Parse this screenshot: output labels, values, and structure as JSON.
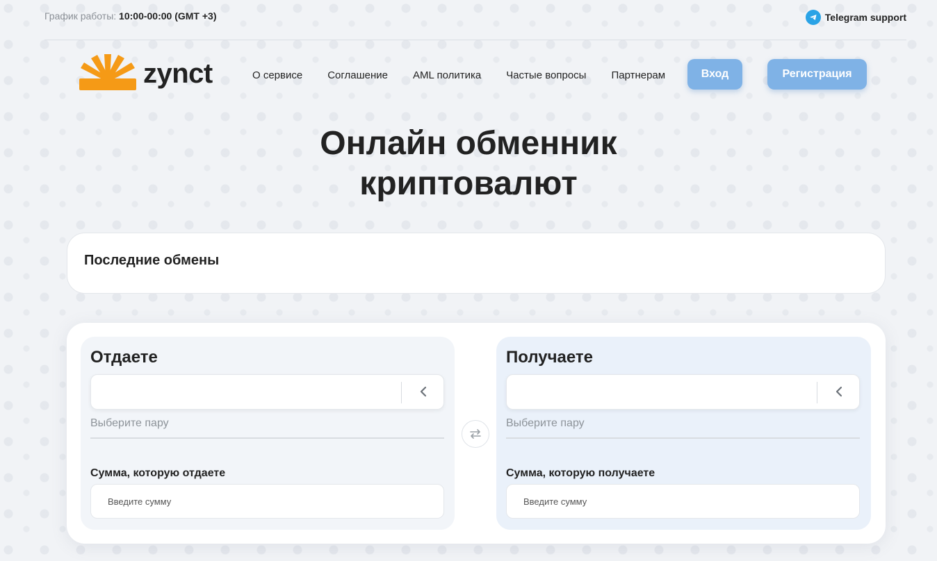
{
  "topbar": {
    "schedule_label": "График работы:",
    "schedule_value": "10:00-00:00 (GMT +3)",
    "telegram_label": "Telegram support"
  },
  "header": {
    "logo_text": "zynct",
    "nav": [
      {
        "label": "О сервисе"
      },
      {
        "label": "Соглашение"
      },
      {
        "label": "AML политика"
      },
      {
        "label": "Частые вопросы"
      },
      {
        "label": "Партнерам"
      }
    ],
    "login_label": "Вход",
    "register_label": "Регистрация"
  },
  "hero": {
    "line1": "Онлайн обменник",
    "line2": "криптовалют"
  },
  "recent": {
    "title": "Последние обмены"
  },
  "exchange": {
    "give": {
      "title": "Отдаете",
      "pair_hint": "Выберите пару",
      "amount_label": "Сумма, которую отдаете",
      "amount_placeholder": "Введите сумму"
    },
    "receive": {
      "title": "Получаете",
      "pair_hint": "Выберите пару",
      "amount_label": "Сумма, которую получаете",
      "amount_placeholder": "Введите сумму"
    }
  },
  "colors": {
    "accent_button": "#7fb2e6",
    "logo_orange": "#f59a16",
    "telegram_blue": "#2aa3e6"
  },
  "icons": [
    "telegram-icon",
    "logo-burst-icon",
    "chevron-left-icon",
    "swap-arrows-icon"
  ]
}
